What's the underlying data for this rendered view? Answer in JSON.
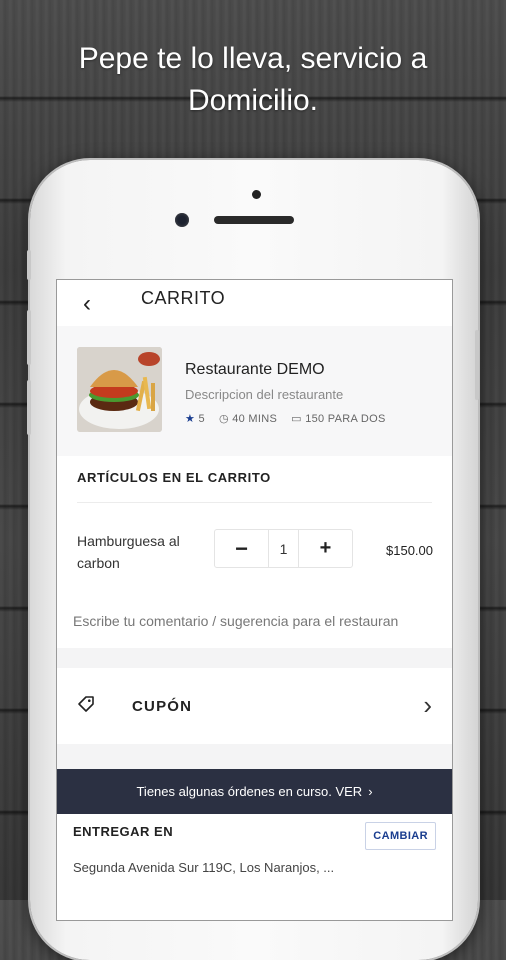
{
  "promo": {
    "headline_line1": "Pepe te lo lleva, servicio a",
    "headline_line2": "Domicilio."
  },
  "header": {
    "back": "‹",
    "title": "CARRITO"
  },
  "restaurant": {
    "name": "Restaurante DEMO",
    "description": "Descripcion del restaurante",
    "rating": "5",
    "time": "40 MINS",
    "price_for_two": "150 PARA DOS"
  },
  "cart": {
    "section_title": "ARTÍCULOS EN EL CARRITO",
    "item": {
      "name_line1": "Hamburguesa al",
      "name_line2": "carbon",
      "quantity": "1",
      "price": "$150.00",
      "minus": "−",
      "plus": "+"
    },
    "comment_placeholder": "Escribe tu comentario / sugerencia para el restauran"
  },
  "coupon": {
    "label": "CUPÓN",
    "chevron": "›"
  },
  "orders_banner": {
    "text": "Tienes algunas órdenes en curso. VER",
    "chevron": "›"
  },
  "delivery": {
    "title": "ENTREGAR EN",
    "change_button": "CAMBIAR",
    "address": "Segunda Avenida Sur 119C, Los Naranjos, ..."
  },
  "colors": {
    "accent": "#1a3d8f",
    "banner": "#2b3042"
  }
}
